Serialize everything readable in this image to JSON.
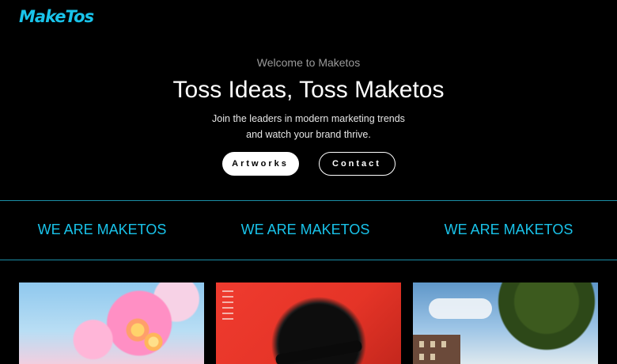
{
  "brand": {
    "logo": "MakeTos"
  },
  "hero": {
    "eyebrow": "Welcome to Maketos",
    "headline": "Toss Ideas, Toss Maketos",
    "sub_line1": "Join the leaders in modern marketing trends",
    "sub_line2": "and watch your brand thrive.",
    "primary_button": "Artworks",
    "secondary_button": "Contact"
  },
  "band": {
    "items": [
      "WE ARE MAKETOS",
      "WE ARE MAKETOS",
      "WE ARE MAKETOS"
    ]
  },
  "gallery": {
    "items": [
      {
        "name": "pink-clouds-flowers-artwork"
      },
      {
        "name": "red-portrait-artwork"
      },
      {
        "name": "tree-building-sky-artwork"
      }
    ]
  },
  "colors": {
    "accent": "#19c3ea",
    "divider": "#1b8ea6",
    "background": "#000000",
    "text": "#ffffff"
  }
}
